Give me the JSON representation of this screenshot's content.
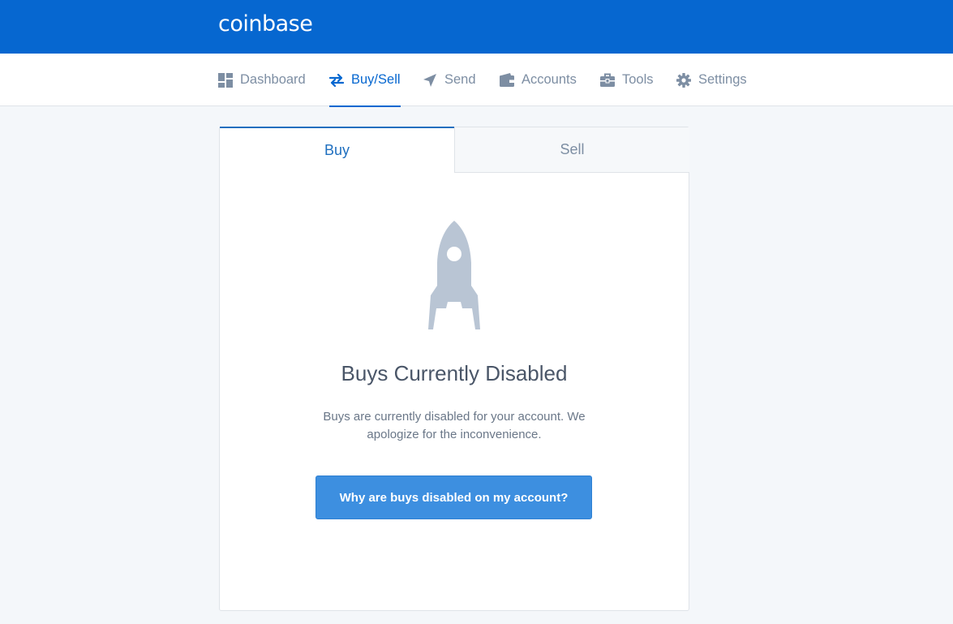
{
  "header": {
    "logo": "coinbase"
  },
  "nav": {
    "items": [
      {
        "label": "Dashboard",
        "icon": "dashboard-grid-icon",
        "active": false
      },
      {
        "label": "Buy/Sell",
        "icon": "exchange-arrows-icon",
        "active": true
      },
      {
        "label": "Send",
        "icon": "paper-plane-icon",
        "active": false
      },
      {
        "label": "Accounts",
        "icon": "wallet-icon",
        "active": false
      },
      {
        "label": "Tools",
        "icon": "toolbox-icon",
        "active": false
      },
      {
        "label": "Settings",
        "icon": "gear-icon",
        "active": false
      }
    ]
  },
  "tabs": {
    "buy": "Buy",
    "sell": "Sell",
    "selected": "Buy"
  },
  "main": {
    "icon": "rocket-icon",
    "title": "Buys Currently Disabled",
    "description": "Buys are currently disabled for your account. We apologize for the inconvenience.",
    "button_label": "Why are buys disabled on my account?"
  },
  "colors": {
    "brand": "#0667d0",
    "nav_inactive": "#7d8ea3",
    "button": "#3d8fe0",
    "background": "#f4f7fa",
    "icon_gray": "#b9c5d4"
  }
}
